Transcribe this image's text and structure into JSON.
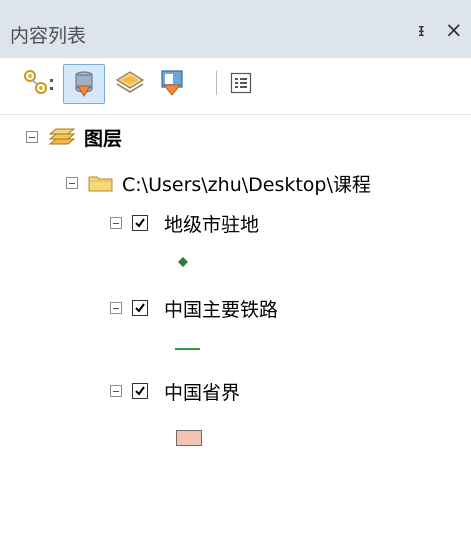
{
  "window": {
    "title": "内容列表",
    "pin_glyph": "ᵻ",
    "close_glyph": "×"
  },
  "toolbar": {
    "buttons": [
      {
        "name": "list-by-drawing-order",
        "icon": "list-by-drawing-order-icon"
      },
      {
        "name": "list-by-source",
        "icon": "list-by-source-icon",
        "selected": true
      },
      {
        "name": "list-by-visibility",
        "icon": "list-by-visibility-icon"
      },
      {
        "name": "list-by-selection",
        "icon": "list-by-selection-icon"
      },
      {
        "name": "options",
        "icon": "options-icon"
      }
    ]
  },
  "tree": {
    "root": {
      "label": "图层",
      "icon": "layers-icon"
    },
    "folder": {
      "label": "C:\\Users\\zhu\\Desktop\\课程",
      "icon": "folder-icon"
    },
    "layers": [
      {
        "label": "地级市驻地",
        "checked": true,
        "symbol": "point",
        "symbol_color": "#2e7d32"
      },
      {
        "label": "中国主要铁路",
        "checked": true,
        "symbol": "line",
        "symbol_color": "#2e9e3e"
      },
      {
        "label": "中国省界",
        "checked": true,
        "symbol": "polygon",
        "symbol_color": "#f4c3b4"
      }
    ]
  }
}
